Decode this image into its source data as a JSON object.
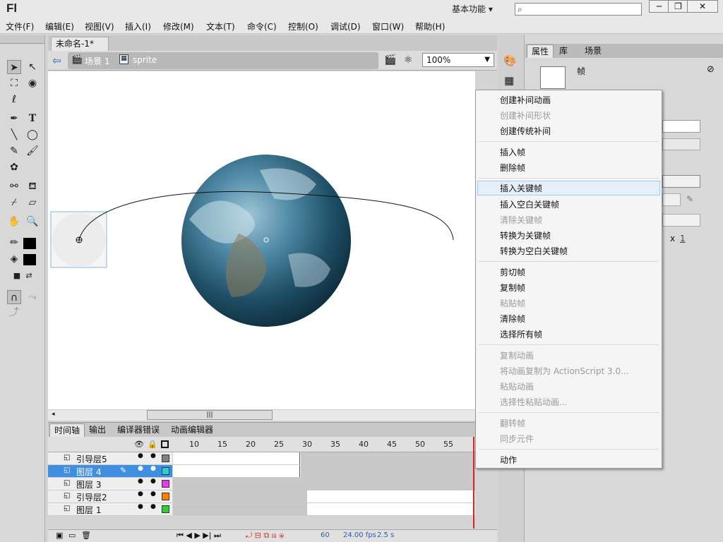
{
  "app": {
    "logo": "Fl",
    "workspace": "基本功能"
  },
  "menubar": [
    "文件(F)",
    "编辑(E)",
    "视图(V)",
    "插入(I)",
    "修改(M)",
    "文本(T)",
    "命令(C)",
    "控制(O)",
    "调试(D)",
    "窗口(W)",
    "帮助(H)"
  ],
  "document": {
    "tab_title": "未命名-1*",
    "close": "×"
  },
  "editbar": {
    "scene": "场景 1",
    "symbol": "sprite",
    "zoom": "100%"
  },
  "timeline": {
    "tabs": [
      "时间轴",
      "输出",
      "编译器错误",
      "动画编辑器"
    ],
    "frame_numbers": [
      "10",
      "15",
      "20",
      "25",
      "30",
      "35",
      "40",
      "45",
      "50",
      "55"
    ],
    "layers": [
      {
        "name": "引导层5",
        "color": "#808080"
      },
      {
        "name": "图层 4",
        "color": "#33cccc"
      },
      {
        "name": "图层 3",
        "color": "#e040e0"
      },
      {
        "name": "引导层2",
        "color": "#ff8000"
      },
      {
        "name": "图层 1",
        "color": "#33cc33"
      }
    ],
    "status": {
      "frame": "60",
      "fps": "24.00 fps",
      "time": "2.5 s"
    }
  },
  "right_panel": {
    "tabs": [
      "属性",
      "库",
      "场景"
    ],
    "frame_label": "帧",
    "x_label": "x",
    "x_value": "1"
  },
  "context_menu": {
    "groups": [
      [
        {
          "label": "创建补间动画",
          "enabled": true
        },
        {
          "label": "创建补间形状",
          "enabled": false
        },
        {
          "label": "创建传统补间",
          "enabled": true
        }
      ],
      [
        {
          "label": "插入帧",
          "enabled": true
        },
        {
          "label": "删除帧",
          "enabled": true
        }
      ],
      [
        {
          "label": "插入关键帧",
          "enabled": true,
          "highlighted": true
        },
        {
          "label": "插入空白关键帧",
          "enabled": true
        },
        {
          "label": "清除关键帧",
          "enabled": false
        },
        {
          "label": "转换为关键帧",
          "enabled": true
        },
        {
          "label": "转换为空白关键帧",
          "enabled": true
        }
      ],
      [
        {
          "label": "剪切帧",
          "enabled": true
        },
        {
          "label": "复制帧",
          "enabled": true
        },
        {
          "label": "粘贴帧",
          "enabled": false
        },
        {
          "label": "清除帧",
          "enabled": true
        },
        {
          "label": "选择所有帧",
          "enabled": true
        }
      ],
      [
        {
          "label": "复制动画",
          "enabled": false
        },
        {
          "label": "将动画复制为 ActionScript 3.0...",
          "enabled": false
        },
        {
          "label": "粘贴动画",
          "enabled": false
        },
        {
          "label": "选择性粘贴动画...",
          "enabled": false
        }
      ],
      [
        {
          "label": "翻转帧",
          "enabled": false
        },
        {
          "label": "同步元件",
          "enabled": false
        }
      ],
      [
        {
          "label": "动作",
          "enabled": true
        }
      ]
    ]
  },
  "colors": {
    "selection": "#3f8ee0",
    "playhead": "#e02020",
    "menu_highlight": "#e4effa"
  }
}
